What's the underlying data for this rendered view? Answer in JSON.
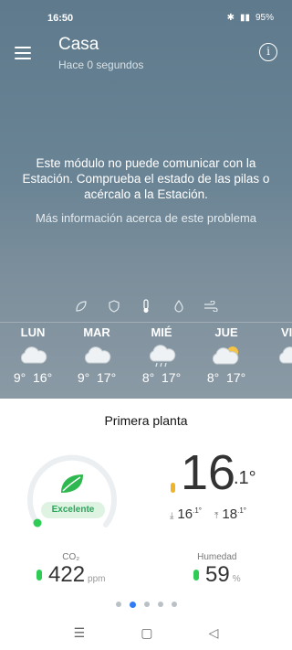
{
  "status": {
    "time": "16:50",
    "battery": "95%"
  },
  "header": {
    "title": "Casa",
    "subtitle": "Hace 0 segundos",
    "info_symbol": "i"
  },
  "alert": {
    "message": "Este módulo no puede comunicar con la Estación. Comprueba el estado de las pilas o acércalo a la Estación.",
    "link": "Más información acerca de este problema"
  },
  "metric_icons": [
    "leaf-icon",
    "shield-icon",
    "thermometer-icon",
    "drop-icon",
    "wind-icon"
  ],
  "forecast": [
    {
      "day": "LUN",
      "min": "9°",
      "max": "16°",
      "icon": "cloud-icon"
    },
    {
      "day": "MAR",
      "min": "9°",
      "max": "17°",
      "icon": "cloud-icon"
    },
    {
      "day": "MIÉ",
      "min": "8°",
      "max": "17°",
      "icon": "rain-cloud-icon"
    },
    {
      "day": "JUE",
      "min": "8°",
      "max": "17°",
      "icon": "sun-cloud-icon"
    },
    {
      "day": "VI",
      "min": "",
      "max": "",
      "icon": "cloud-icon"
    }
  ],
  "room": {
    "name": "Primera planta",
    "quality_label": "Excelente",
    "quality_fraction": 0.05,
    "temperature_int": "16",
    "temperature_dec": ".1°",
    "min_int": "16",
    "min_dec": ".1°",
    "max_int": "18",
    "max_dec": ".1°",
    "co2_label": "CO₂",
    "co2_value": "422",
    "co2_unit": "ppm",
    "humidity_label": "Humedad",
    "humidity_value": "59",
    "humidity_unit": "%"
  },
  "pager": {
    "count": 5,
    "active": 1
  },
  "colors": {
    "accent": "#2f7cf6",
    "good": "#2ecc55",
    "warm": "#f0b429"
  }
}
